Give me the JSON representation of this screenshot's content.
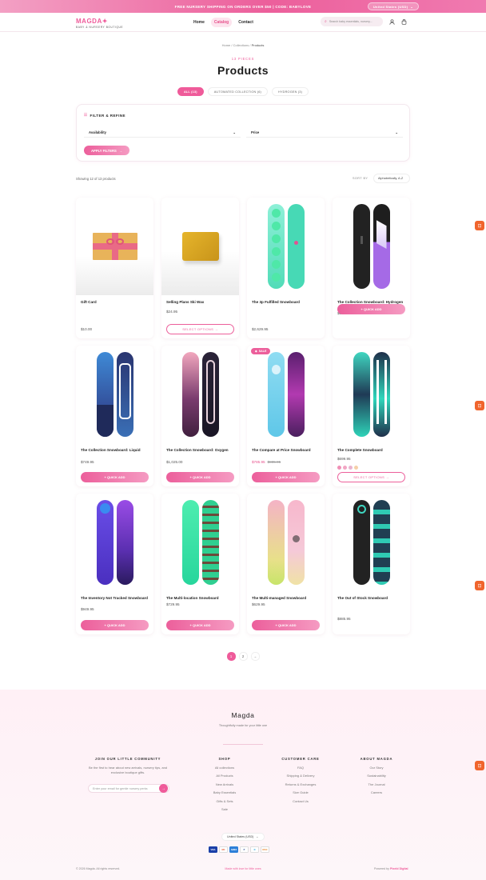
{
  "announcement": {
    "text": "FREE NURSERY SHIPPING ON ORDERS OVER $50 | CODE: BABYLOVE",
    "currency": "United States (USD)"
  },
  "header": {
    "logo": "MAGDA",
    "tagline": "BABY & NURSERY BOUTIQUE",
    "nav": [
      "Home",
      "Catalog",
      "Contact"
    ],
    "search_placeholder": "Search baby essentials, nursery..."
  },
  "breadcrumb": {
    "home": "Home",
    "collections": "Collections",
    "current": "Products"
  },
  "collection": {
    "count": "13 PIECES",
    "title": "Products"
  },
  "tabs": [
    "ALL (13)",
    "AUTOMATED COLLECTION (6)",
    "HYDROGEN (3)"
  ],
  "filter": {
    "title": "FILTER & REFINE",
    "availability": "Availability",
    "price": "Price",
    "apply": "APPLY FILTERS"
  },
  "results": {
    "showing": "Showing 12 of 13 products",
    "sort_label": "SORT BY",
    "sort_value": "Alphabetically, A-Z"
  },
  "products": [
    {
      "name": "Gift Card",
      "price": "$10.00",
      "action": "",
      "kind": "gift"
    },
    {
      "name": "Selling Plans Ski Wax",
      "price": "$24.95",
      "action": "SELECT OPTIONS →",
      "kind": "wax"
    },
    {
      "name": "The 3p Fulfilled Snowboard",
      "price": "$2,629.95",
      "action": "",
      "kind": "board"
    },
    {
      "name": "The Collection Snowboard: Hydrogen",
      "price": "$600.00",
      "action": "+ QUICK ADD",
      "kind": "board"
    },
    {
      "name": "The Collection Snowboard: Liquid",
      "price": "$749.95",
      "action": "+ QUICK ADD",
      "kind": "board"
    },
    {
      "name": "The Collection Snowboard: Oxygen",
      "price": "$1,025.00",
      "action": "+ QUICK ADD",
      "kind": "board"
    },
    {
      "name": "The Compare at Price Snowboard",
      "price": "$785.95",
      "compare": "$885.95",
      "badge": "SALE",
      "action": "+ QUICK ADD",
      "kind": "board"
    },
    {
      "name": "The Complete Snowboard",
      "price": "$699.95",
      "action": "SELECT OPTIONS →",
      "kind": "board",
      "swatches": [
        "#f08fb6",
        "#f2a6c4",
        "#e9b4cf",
        "#f5d0a8"
      ]
    },
    {
      "name": "The Inventory Not Tracked Snowboard",
      "price": "$949.95",
      "action": "+ QUICK ADD",
      "kind": "board"
    },
    {
      "name": "The Multi-location Snowboard",
      "price": "$729.95",
      "action": "+ QUICK ADD",
      "kind": "board"
    },
    {
      "name": "The Multi-managed Snowboard",
      "price": "$629.95",
      "action": "+ QUICK ADD",
      "kind": "board"
    },
    {
      "name": "The Out of Stock Snowboard",
      "price": "$885.95",
      "action": "",
      "kind": "board"
    }
  ],
  "pagination": {
    "pages": [
      "1",
      "2"
    ],
    "next": "→"
  },
  "footer": {
    "brand": "Magda",
    "tagline": "Thoughtfully made for your little one",
    "newsletter_title": "JOIN OUR LITTLE COMMUNITY",
    "newsletter_text": "Be the first to hear about new arrivals, nursery tips, and exclusive boutique gifts.",
    "newsletter_placeholder": "Enter your email for gentle nursery perks",
    "newsletter_button": "→",
    "shop_title": "SHOP",
    "shop_links": [
      "All collections",
      "All Products",
      "New Arrivals",
      "Baby Essentials",
      "Gifts & Sets",
      "Sale"
    ],
    "care_title": "CUSTOMER CARE",
    "care_links": [
      "FAQ",
      "Shipping & Delivery",
      "Returns & Exchanges",
      "Size Guide",
      "Contact Us"
    ],
    "about_title": "ABOUT MAGDA",
    "about_links": [
      "Our Story",
      "Sustainability",
      "The Journal",
      "Careers"
    ],
    "country": "United States (USD)",
    "payments": [
      "VISA",
      "MC",
      "AMEX",
      "P",
      "D",
      "DISC"
    ],
    "copyright": "© 2026 Magda. All rights reserved.",
    "made": "Made with love for little ones",
    "powered": "Powered by",
    "powered_brand": "Pixeld Digital"
  },
  "colors": {
    "accent": "#ef5b9a",
    "accent_light": "#fde4ee",
    "fab": "#f0652d"
  }
}
